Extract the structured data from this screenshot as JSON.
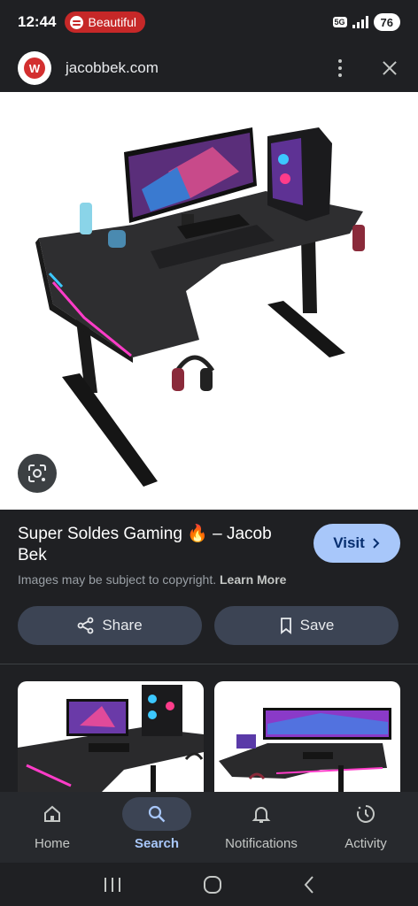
{
  "status_bar": {
    "time": "12:44",
    "media_label": "Beautiful",
    "network": "5G",
    "battery": "76"
  },
  "header": {
    "domain": "jacobbek.com",
    "logo_letter": "W"
  },
  "result": {
    "title": "Super Soldes Gaming 🔥 – Jacob Bek",
    "visit_label": "Visit",
    "copyright_text": "Images may be subject to copyright.",
    "learn_more": "Learn More",
    "share_label": "Share",
    "save_label": "Save"
  },
  "icons": {
    "lens": "google-lens-icon",
    "share": "share-icon",
    "save": "bookmark-icon",
    "visit": "chevron-right-icon"
  },
  "nav": {
    "items": [
      {
        "label": "Home",
        "icon": "home-icon"
      },
      {
        "label": "Search",
        "icon": "search-icon"
      },
      {
        "label": "Notifications",
        "icon": "bell-icon"
      },
      {
        "label": "Activity",
        "icon": "activity-icon"
      }
    ],
    "active": "Search"
  },
  "colors": {
    "background": "#1f2023",
    "accent": "#a8c7fa",
    "pill": "#3c4454",
    "media_pill": "#c62828"
  }
}
